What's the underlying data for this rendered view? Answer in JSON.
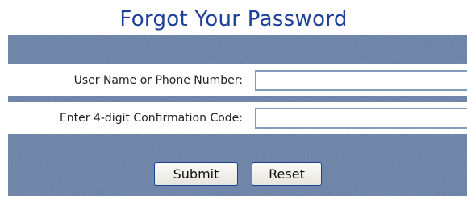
{
  "title": "Forgot Your Password",
  "form": {
    "username_label": "User Name or Phone Number:",
    "username_value": "",
    "code_label": "Enter 4-digit Confirmation Code:",
    "code_value": "",
    "submit_label": "Submit",
    "reset_label": "Reset"
  },
  "colors": {
    "title": "#1c3f9a",
    "panel": "#6f86aa",
    "row_background": "#ffffff"
  }
}
